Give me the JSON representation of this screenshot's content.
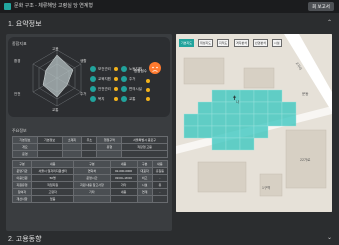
{
  "app": {
    "title": "문화 구조 - 체류해당 고령실 당 연계형",
    "button": "회 보고서"
  },
  "sections": {
    "first": "1. 요약정보",
    "second": "2. 고용동향"
  },
  "radar": {
    "caption": "종합지표",
    "axes": [
      "고용",
      "생활",
      "주거",
      "교통",
      "안전",
      "환경"
    ]
  },
  "indicators": [
    {
      "label": "보건관리",
      "value": "89"
    },
    {
      "label": "교육지원",
      "value": "62"
    },
    {
      "label": "안전관리",
      "value": "78"
    },
    {
      "label": "복지",
      "value": "54"
    }
  ],
  "indicators_right": [
    {
      "label": "노동지원",
      "value": "71"
    },
    {
      "label": "주거",
      "value": "46"
    },
    {
      "label": "편의시설",
      "value": "63"
    },
    {
      "label": "교통",
      "value": "58"
    }
  ],
  "risk_label": "종합점수",
  "info_caption": "주요정보",
  "info_table": {
    "rows": [
      [
        "기본정보",
        "기본정보",
        "소재지",
        "주소",
        "행정구역",
        "서울특별시 종로구"
      ],
      [
        "개요",
        "",
        "",
        "",
        "유형",
        "직장형 고용"
      ],
      [
        "운영",
        "",
        "",
        "",
        "",
        ""
      ]
    ]
  },
  "detail_table": {
    "rows": [
      [
        "구분",
        "내용",
        "구분",
        "내용",
        "구분",
        "내용"
      ],
      [
        "운영기관",
        "서울시 일자리지원센터",
        "연락처",
        "02-000-0000",
        "대표자",
        "홍길동"
      ],
      [
        "이용인원",
        "50명",
        "운영시간",
        "09:00~18:00",
        "비고",
        "-"
      ],
      [
        "지원유형",
        "직접지원",
        "지원 내용 참고사항",
        "기타",
        "시설",
        "유"
      ],
      [
        "참여자",
        "고령자",
        "기타",
        "내용",
        "연계",
        "-"
      ],
      [
        "개선사항",
        "없음",
        "",
        "",
        "",
        ""
      ]
    ]
  },
  "map_toolbar": [
    "기본지도",
    "위성지도",
    "지적도",
    "격자분석",
    "반경분석",
    "시설"
  ],
  "map_labels": {
    "building": "나",
    "road_a": "2거리",
    "road_b": "문동",
    "block": "1구역",
    "block2": "22가로"
  },
  "colors": {
    "accent": "#22a7a0",
    "grid": "#3fc8c0",
    "risk": "#ff7a2f"
  }
}
